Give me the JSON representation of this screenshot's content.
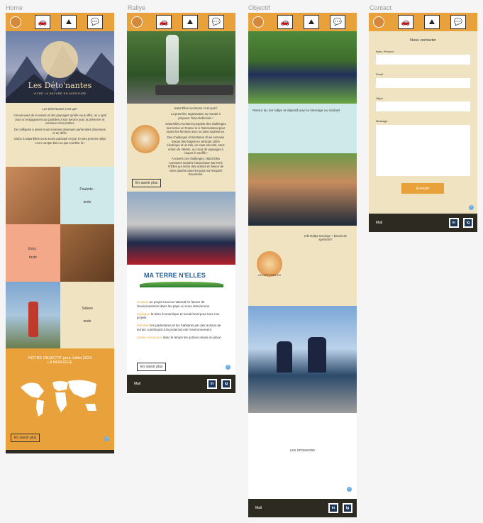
{
  "frames": {
    "home": {
      "label": "Home"
    },
    "rallye": {
      "label": "Rallye"
    },
    "objectif": {
      "label": "Objectif"
    },
    "contact": {
      "label": "Contact"
    }
  },
  "nav": {
    "icons": [
      "car-icon",
      "people-icon",
      "chat-icon"
    ],
    "logo_text": "Les Déto'nantes"
  },
  "home": {
    "brand_title": "Les Déto'nantes",
    "brand_tagline": "VIVRE LA NATURE EN AVENTURE",
    "intro_title": "Les Déto'Nantes c'est qui?",
    "intro_p1": "Amoureuses de la nature et des paysages qu'elle nous offre, on a opté pour un engagement au quotidien à son service pour la préserver et continuer d'en profiter.",
    "intro_p2": "De collègues à amies nous sommes devenues partenaires d'aventure et de défis.",
    "intro_p3": "Grâce à Natur'Elles nous avons participé en juin à notre premier rallye et on compte bien ne pas s'arrêter là !",
    "member1_name": "Paulette :",
    "member1_text": "texte",
    "member2_name": "Vicky :",
    "member2_text": "texte",
    "member3_name": "Sirleen",
    "member3_text": "texte",
    "objective_line1": "NOTRE OBJECTIF pour Juillet 2023",
    "objective_line2": "LA NORVÈGE",
    "cta": "En savoir plus"
  },
  "rallye": {
    "title": "Natur'Elles Aventures c'est quoi?",
    "p1": "La première organisation au monde à proposer l'éleccitoféminin !",
    "p2": "Natur'Elles Aventures propose des challenges tout inclus en France et à l'International pour toutes les femmes avec ou sans expérience.",
    "p3": "Des challenges d'orientation d'une semaine mixant des étapes en véhicule 100% électrique et un trek, en toute sécurité, sans notion de vitesse, au cœur de paysages à couper le souffle !",
    "p4": "À travers ces challenges, Natur'Elles Aventures soutient l'association Ma Terre N'Elles qui mène des actions en faveur de notre planète dans les pays sur lesquels traversons.",
    "cta1": "En savoir plus",
    "ma_terre_logo": "MA TERRE N'ELLES",
    "bullets": [
      {
        "key": "Soutient",
        "rest": " un projet local ou national en faveur de l'environnement dans les pays où nous intervenons"
      },
      {
        "key": "Impliquer",
        "rest": " le tissu économique et social local pour tous nos projets"
      },
      {
        "key": "Mobiliser",
        "rest": " les partenaires et les habitants par des actions de terrain contribuant à la protection de l'environnement"
      },
      {
        "key": "Suivre et mesurer",
        "rest": " dans le temps les actions mises en place"
      }
    ],
    "cta2": "En savoir plus"
  },
  "objectif": {
    "block1": "Retour du 1er rallye et objectif pour la Norvège ou souhait",
    "info": "Info Rallye Norvège + besoin de sponsors?",
    "badge": "LES DÉTO'NANTES",
    "sponsors": "LES SPONSORS"
  },
  "contact": {
    "title": "Nous contacter",
    "name_label": "Nom, Prénom :",
    "email_label": "Email :",
    "subject_label": "Objet :",
    "message_label": "Message :",
    "submit": "Envoyer"
  },
  "footer": {
    "mail": "Mail",
    "linkedin": "in",
    "instagram": "ig"
  },
  "colors": {
    "orange": "#e9a23b",
    "cream": "#efe3c2",
    "teal": "#cfe9ea",
    "salmon": "#f4a88a",
    "dark": "#2d2a22"
  }
}
